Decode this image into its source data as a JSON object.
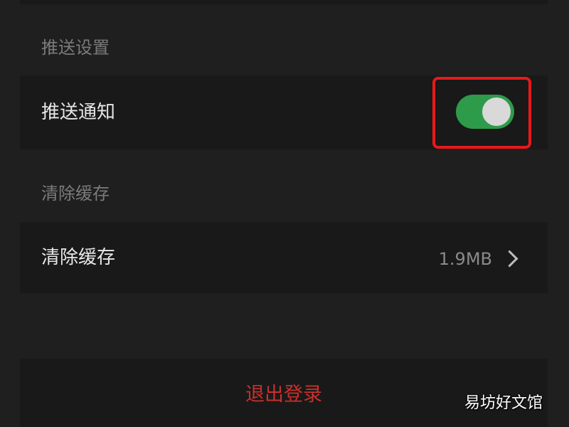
{
  "push_section": {
    "label": "推送设置",
    "notification_label": "推送通知",
    "notification_enabled": true
  },
  "cache_section": {
    "label": "清除缓存",
    "row_label": "清除缓存",
    "size": "1.9MB"
  },
  "logout": {
    "label": "退出登录"
  },
  "watermark": {
    "text": "易坊好文馆"
  },
  "colors": {
    "background": "#1f1f1f",
    "card": "#191919",
    "toggle_on": "#2e9b4a",
    "logout_text": "#c8302c",
    "highlight": "#e8191c"
  },
  "icons": {
    "chevron": "chevron-right-icon"
  }
}
